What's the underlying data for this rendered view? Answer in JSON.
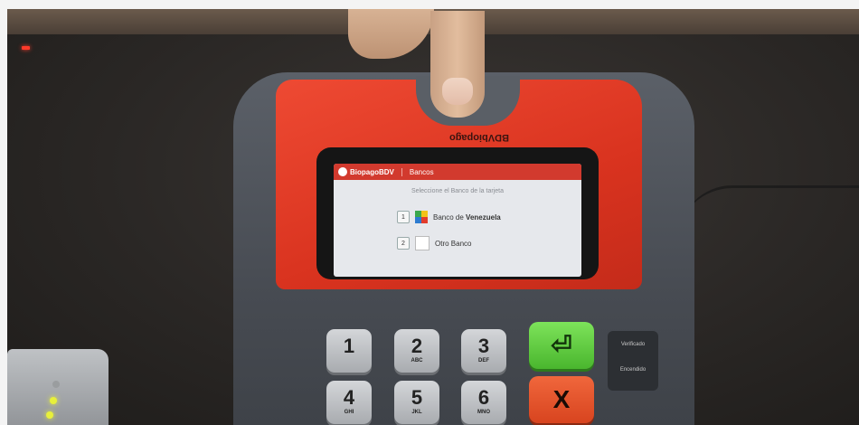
{
  "terminal": {
    "brand_text": "BDVbiopago",
    "screen": {
      "header_brand": "BiopagoBDV",
      "header_section": "Bancos",
      "prompt": "Seleccione el Banco de la tarjeta",
      "options": [
        {
          "number": "1",
          "label_prefix": "Banco de",
          "label_bold": "Venezuela",
          "icon": "bdv-logo-icon"
        },
        {
          "number": "2",
          "label_prefix": "",
          "label_bold": "Otro Banco",
          "icon": "bank-card-icon"
        }
      ]
    },
    "keys": [
      {
        "digit": "1",
        "letters": ""
      },
      {
        "digit": "2",
        "letters": "ABC"
      },
      {
        "digit": "3",
        "letters": "DEF"
      },
      {
        "digit": "4",
        "letters": "GHI"
      },
      {
        "digit": "5",
        "letters": "JKL"
      },
      {
        "digit": "6",
        "letters": "MNO"
      }
    ],
    "enter_symbol": "⏎",
    "cancel_symbol": "X",
    "status": {
      "verified_label": "Verificado",
      "on_label": "Encendido"
    }
  },
  "colors": {
    "cover_red": "#e0391f",
    "enter_green": "#5ccb3d",
    "cancel_orange": "#e24e24",
    "screen_header": "#d23a2e"
  }
}
